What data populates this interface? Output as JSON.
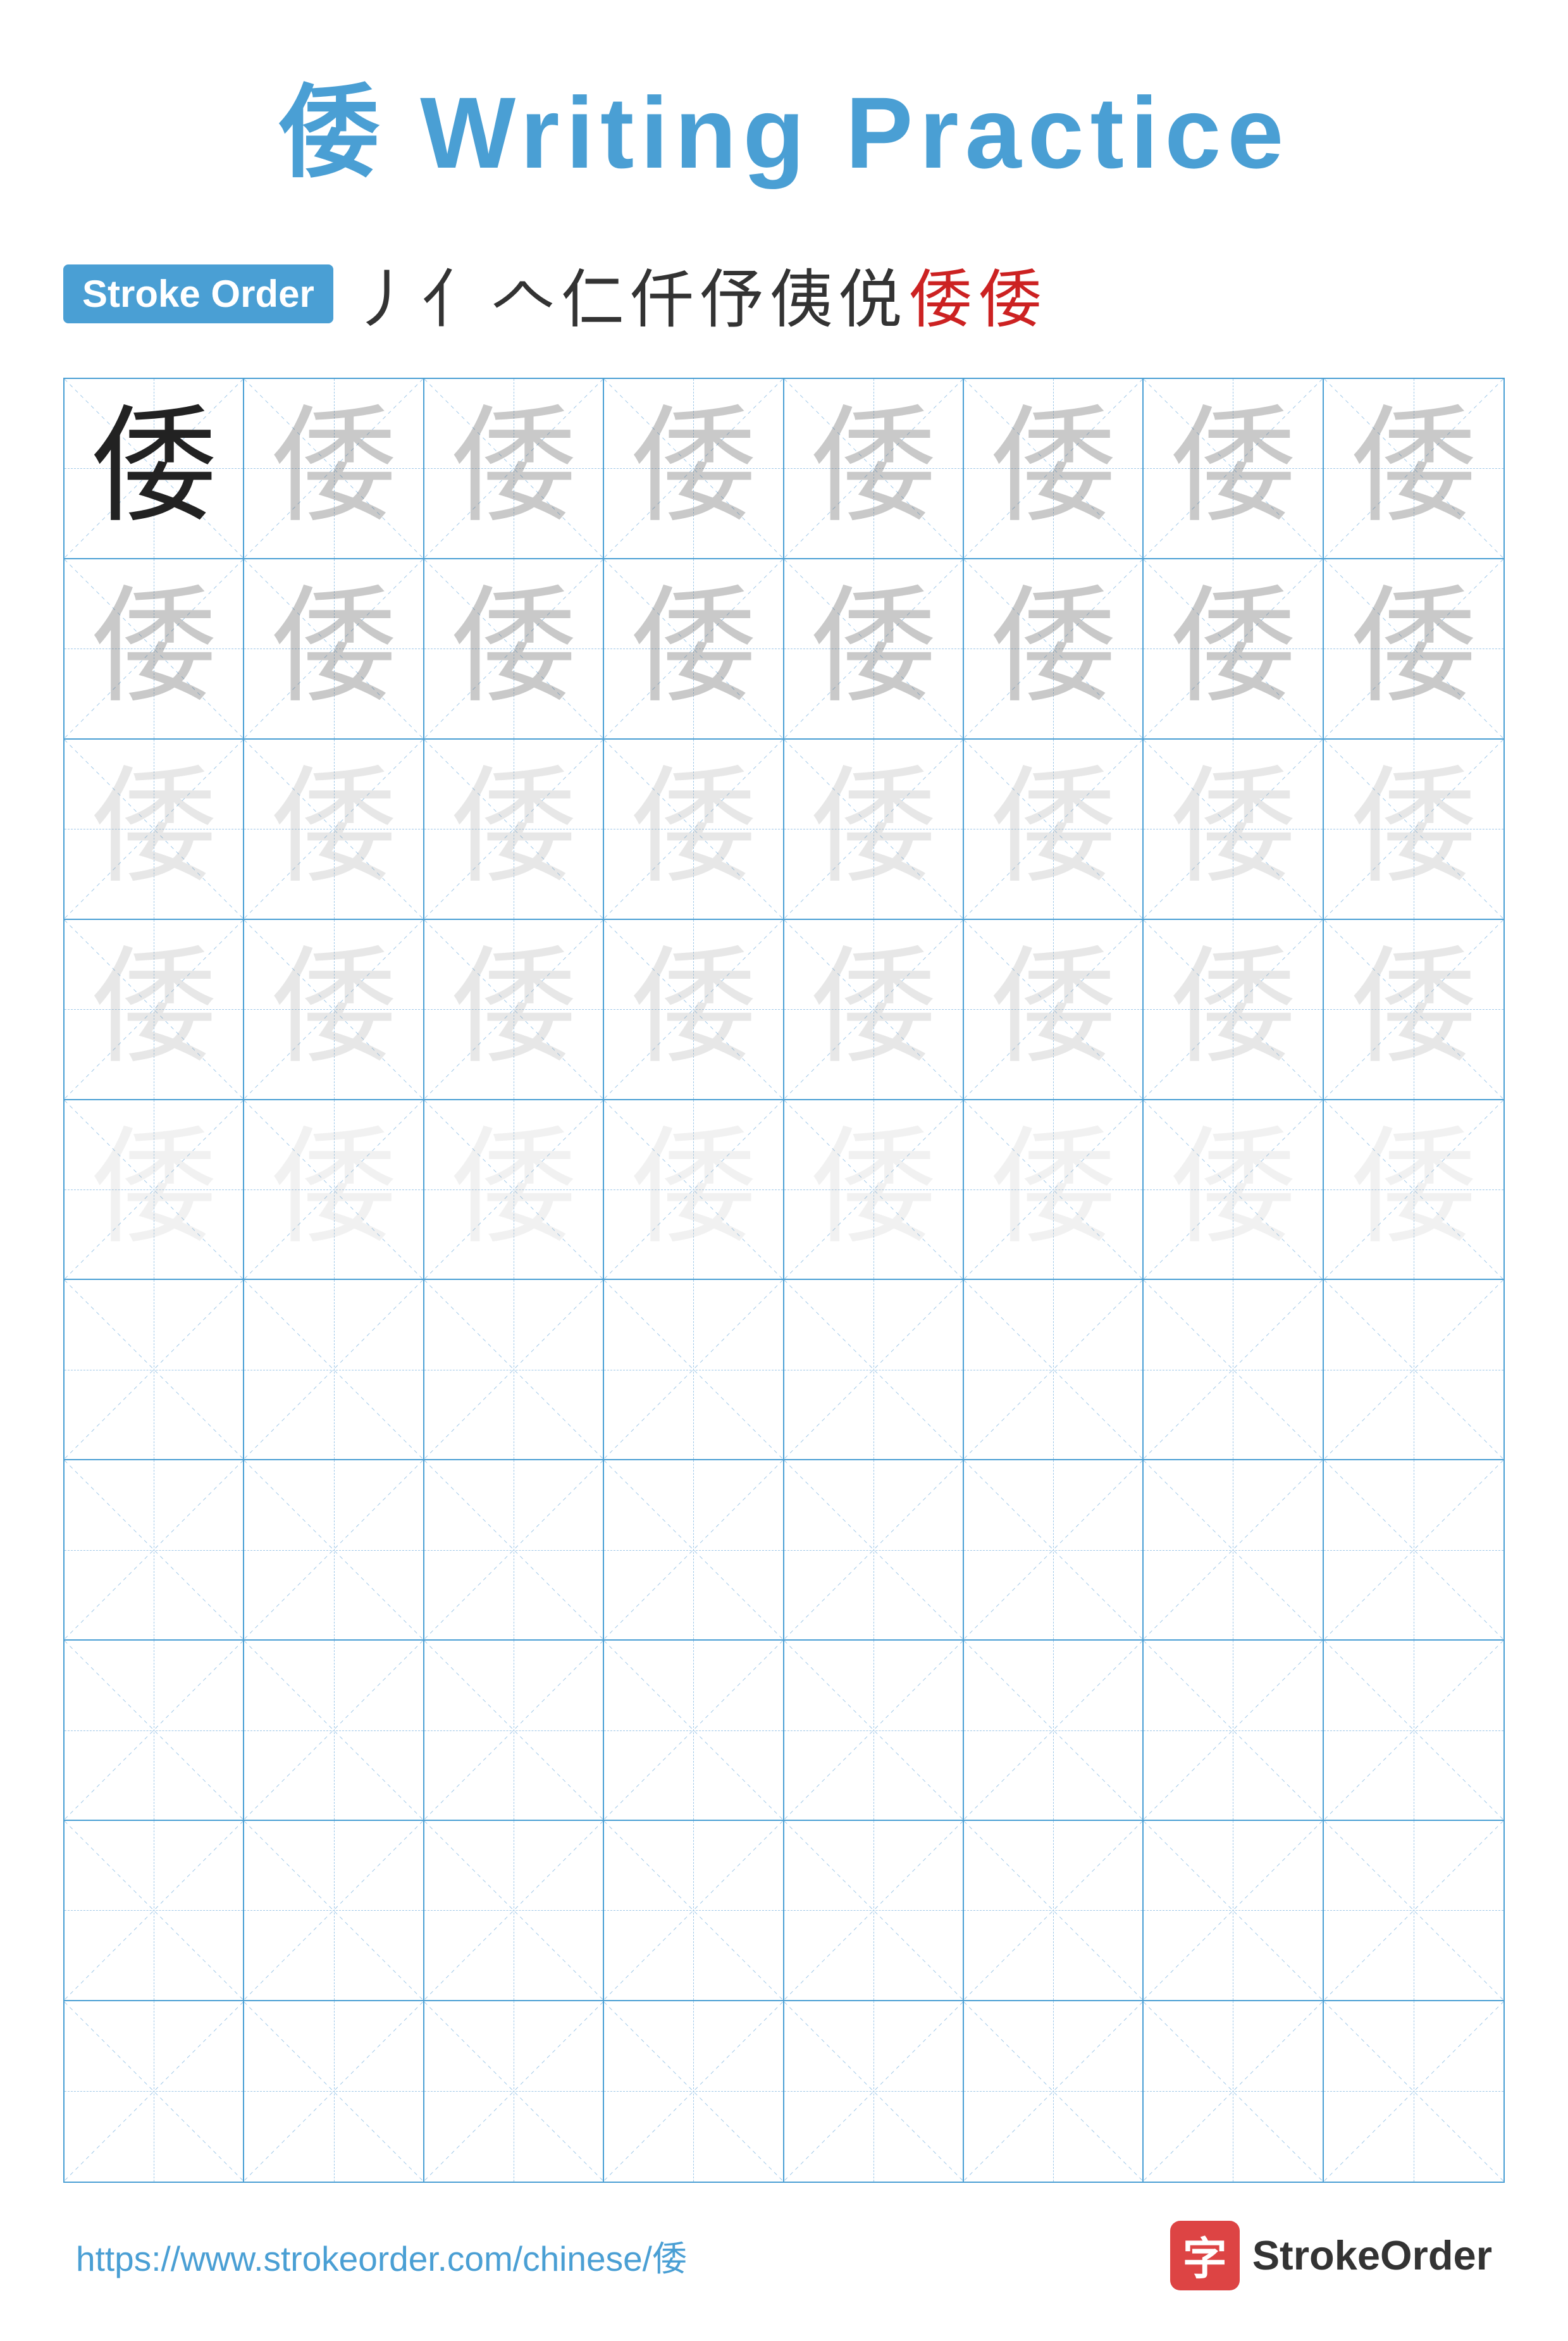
{
  "title": {
    "char": "倭",
    "text": " Writing Practice"
  },
  "stroke_order": {
    "badge_label": "Stroke Order",
    "sequence": [
      "丿",
      "亻",
      "𠆢",
      "仁",
      "仟",
      "伃",
      "侇",
      "侻",
      "倭",
      "倭"
    ]
  },
  "grid": {
    "rows": 10,
    "cols": 8,
    "char": "倭",
    "filled_rows": 5,
    "practice_rows": 5
  },
  "footer": {
    "url": "https://www.strokeorder.com/chinese/倭",
    "logo_char": "字",
    "logo_text": "StrokeOrder"
  }
}
